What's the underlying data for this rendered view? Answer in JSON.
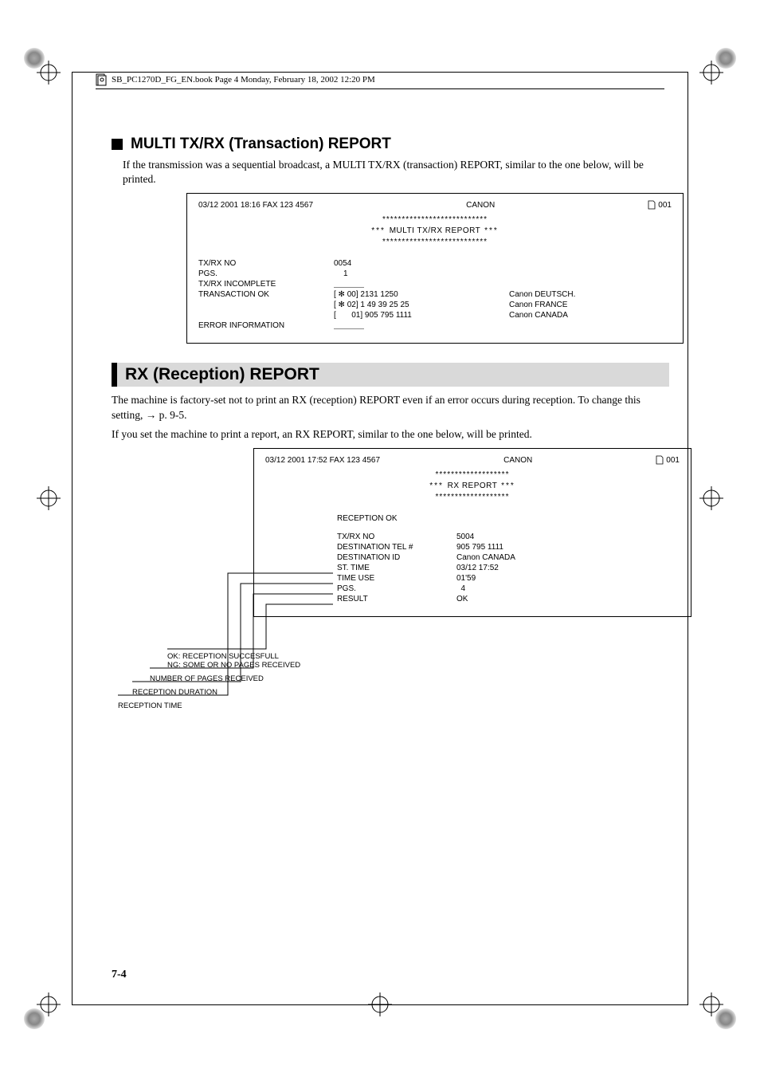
{
  "header": {
    "book_line": "SB_PC1270D_FG_EN.book  Page 4  Monday, February 18, 2002  12:20 PM"
  },
  "section1": {
    "title": "MULTI TX/RX (Transaction) REPORT",
    "intro": "If the transmission was a sequential broadcast, a MULTI TX/RX (transaction) REPORT, similar to the one below, will be printed."
  },
  "report1": {
    "hdr_left": "03/12 2001 18:16 FAX 123 4567",
    "hdr_center": "CANON",
    "hdr_right": "001",
    "stars": "***************************",
    "title_pre": "***",
    "title": "MULTI TX/RX REPORT",
    "title_post": "***",
    "rows": {
      "txrx_no_lbl": "TX/RX NO",
      "txrx_no_val": "0054",
      "pgs_lbl": "PGS.",
      "pgs_val": "1",
      "incomplete_lbl": "TX/RX INCOMPLETE",
      "ok_lbl": "TRANSACTION OK",
      "ok_1_mid": "[ ✻   00] 2131 1250",
      "ok_1_rgt": "Canon DEUTSCH.",
      "ok_2_mid": "[ ✻   02] 1 49 39 25 25",
      "ok_2_rgt": "Canon FRANCE",
      "ok_3_mid": "[       01] 905 795 1111",
      "ok_3_rgt": "Canon CANADA",
      "err_lbl": "ERROR INFORMATION"
    }
  },
  "section2": {
    "title": "RX (Reception) REPORT",
    "para1_a": "The machine is factory-set not to print an RX (reception) REPORT even if an error occurs during reception. To change this setting, ",
    "para1_b": " p. 9-5.",
    "para2": "If you set the machine to print a report, an RX REPORT, similar to the one below, will be printed."
  },
  "report2": {
    "hdr_left": "03/12 2001 17:52 FAX 123 4567",
    "hdr_center": "CANON",
    "hdr_right": "001",
    "stars": "*******************",
    "title_pre": "***",
    "title": "RX REPORT",
    "title_post": "***",
    "status": "RECEPTION OK",
    "rows": {
      "txrx_no_lbl": "TX/RX NO",
      "txrx_no_val": "5004",
      "dest_tel_lbl": "DESTINATION TEL #",
      "dest_tel_val": "905 795 1111",
      "dest_id_lbl": "DESTINATION ID",
      "dest_id_val": "Canon CANADA",
      "st_time_lbl": "ST. TIME",
      "st_time_val": "03/12 17:52",
      "time_use_lbl": "TIME USE",
      "time_use_val": "01'59",
      "pgs_lbl": "PGS.",
      "pgs_val": "  4",
      "result_lbl": "RESULT",
      "result_val": "OK"
    }
  },
  "callouts": {
    "c1a": "OK: RECEPTION SUCCESFULL",
    "c1b": "NG: SOME OR NO PAGES RECEIVED",
    "c2": "NUMBER OF PAGES RECEIVED",
    "c3": "RECEPTION DURATION",
    "c4": "RECEPTION TIME"
  },
  "page_number": "7-4"
}
